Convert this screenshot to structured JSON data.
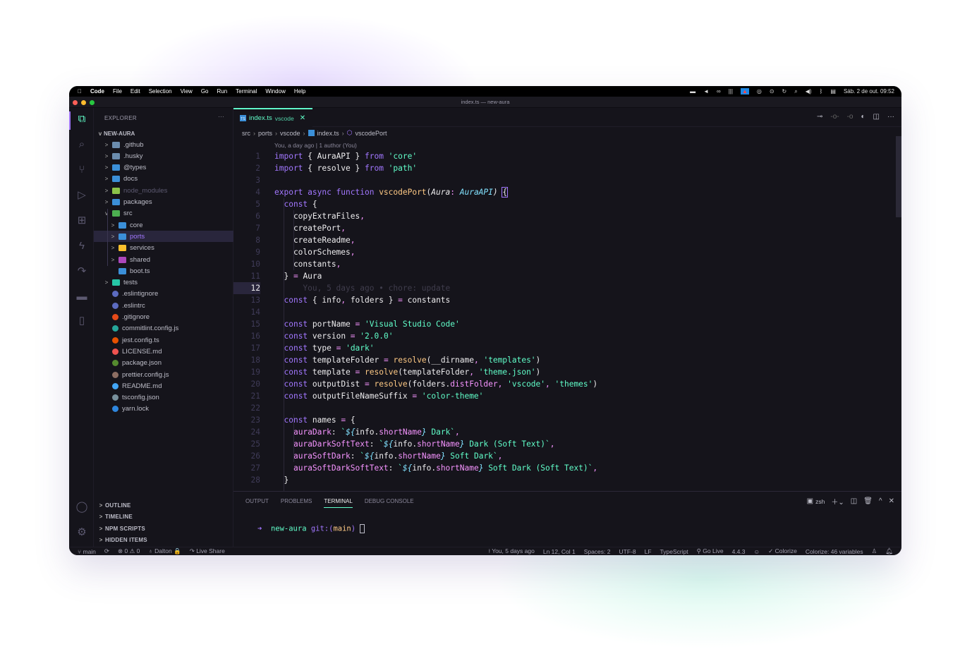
{
  "menubar": {
    "apple": "",
    "app": "Code",
    "items": [
      "File",
      "Edit",
      "Selection",
      "View",
      "Go",
      "Run",
      "Terminal",
      "Window",
      "Help"
    ],
    "clock": "Sáb. 2 de out.  09:52"
  },
  "window_title": "index.ts — new-aura",
  "colors": {
    "accent": "#61ffca",
    "purple": "#a277ff",
    "bg": "#15141b"
  },
  "sidebar": {
    "title": "EXPLORER",
    "more": "···",
    "root": "NEW-AURA",
    "items": [
      {
        "label": ".github",
        "depth": 0,
        "chev": ">",
        "color": "#6b8cae"
      },
      {
        "label": ".husky",
        "depth": 0,
        "chev": ">",
        "color": "#6b8cae"
      },
      {
        "label": "@types",
        "depth": 0,
        "chev": ">",
        "color": "#3b8fd8"
      },
      {
        "label": "docs",
        "depth": 0,
        "chev": ">",
        "color": "#3b8fd8"
      },
      {
        "label": "node_modules",
        "depth": 0,
        "chev": ">",
        "color": "#8bc34a",
        "dim": true
      },
      {
        "label": "packages",
        "depth": 0,
        "chev": ">",
        "color": "#3b8fd8"
      },
      {
        "label": "src",
        "depth": 0,
        "chev": "v",
        "color": "#4caf50"
      },
      {
        "label": "core",
        "depth": 1,
        "chev": ">",
        "color": "#3b8fd8"
      },
      {
        "label": "ports",
        "depth": 1,
        "chev": ">",
        "color": "#3b8fd8",
        "selected": true
      },
      {
        "label": "services",
        "depth": 1,
        "chev": ">",
        "color": "#fbc02d"
      },
      {
        "label": "shared",
        "depth": 1,
        "chev": ">",
        "color": "#ab47bc"
      },
      {
        "label": "boot.ts",
        "depth": 1,
        "chev": "",
        "color": "#3b8fd8"
      },
      {
        "label": "tests",
        "depth": 0,
        "chev": ">",
        "color": "#26c6a6"
      },
      {
        "label": ".eslintignore",
        "depth": 0,
        "chev": "",
        "color": "#5c6bc0",
        "file": true
      },
      {
        "label": ".eslintrc",
        "depth": 0,
        "chev": "",
        "color": "#5c6bc0",
        "file": true
      },
      {
        "label": ".gitignore",
        "depth": 0,
        "chev": "",
        "color": "#e64a19",
        "file": true
      },
      {
        "label": "commitlint.config.js",
        "depth": 0,
        "chev": "",
        "color": "#26a69a",
        "file": true
      },
      {
        "label": "jest.config.ts",
        "depth": 0,
        "chev": "",
        "color": "#e65100",
        "file": true
      },
      {
        "label": "LICENSE.md",
        "depth": 0,
        "chev": "",
        "color": "#ef5350",
        "file": true
      },
      {
        "label": "package.json",
        "depth": 0,
        "chev": "",
        "color": "#558b2f",
        "file": true
      },
      {
        "label": "prettier.config.js",
        "depth": 0,
        "chev": "",
        "color": "#8d6e63",
        "file": true
      },
      {
        "label": "README.md",
        "depth": 0,
        "chev": "",
        "color": "#42a5f5",
        "file": true
      },
      {
        "label": "tsconfig.json",
        "depth": 0,
        "chev": "",
        "color": "#78909c",
        "file": true
      },
      {
        "label": "yarn.lock",
        "depth": 0,
        "chev": "",
        "color": "#2e86de",
        "file": true
      }
    ],
    "sections": [
      "OUTLINE",
      "TIMELINE",
      "NPM SCRIPTS",
      "HIDDEN ITEMS"
    ]
  },
  "tab": {
    "name": "index.ts",
    "desc": "vscode",
    "icon": "TS"
  },
  "breadcrumbs": [
    "src",
    "ports",
    "vscode",
    "index.ts",
    "vscodePort"
  ],
  "blame_top": "You, a day ago | 1 author (You)",
  "current_line": 12,
  "code": [
    [
      [
        "k",
        "import"
      ],
      [
        "t",
        " { AuraAPI } "
      ],
      [
        "k",
        "from"
      ],
      [
        "s",
        " 'core'"
      ]
    ],
    [
      [
        "k",
        "import"
      ],
      [
        "t",
        " { resolve } "
      ],
      [
        "k",
        "from"
      ],
      [
        "s",
        " 'path'"
      ]
    ],
    [],
    [
      [
        "k",
        "export async function "
      ],
      [
        "f",
        "vscodePort"
      ],
      [
        "t",
        "("
      ],
      [
        "pa",
        "Aura"
      ],
      [
        "o",
        ": "
      ],
      [
        "ty",
        "AuraAPI"
      ],
      [
        "pa",
        ")"
      ],
      [
        "t",
        " "
      ],
      [
        "b",
        "{"
      ]
    ],
    [
      [
        "t",
        "  "
      ],
      [
        "k",
        "const"
      ],
      [
        "t",
        " {"
      ]
    ],
    [
      [
        "t",
        "    copyExtraFiles"
      ],
      [
        "o",
        ","
      ]
    ],
    [
      [
        "t",
        "    createPort"
      ],
      [
        "o",
        ","
      ]
    ],
    [
      [
        "t",
        "    createReadme"
      ],
      [
        "o",
        ","
      ]
    ],
    [
      [
        "t",
        "    colorSchemes"
      ],
      [
        "o",
        ","
      ]
    ],
    [
      [
        "t",
        "    constants"
      ],
      [
        "o",
        ","
      ]
    ],
    [
      [
        "t",
        "  } "
      ],
      [
        "o",
        "="
      ],
      [
        "t",
        " Aura"
      ]
    ],
    [
      [
        "g",
        "      You, 5 days ago • chore: update"
      ]
    ],
    [
      [
        "t",
        "  "
      ],
      [
        "k",
        "const"
      ],
      [
        "t",
        " { info"
      ],
      [
        "o",
        ","
      ],
      [
        "t",
        " folders } "
      ],
      [
        "o",
        "="
      ],
      [
        "t",
        " constants"
      ]
    ],
    [],
    [
      [
        "t",
        "  "
      ],
      [
        "k",
        "const"
      ],
      [
        "t",
        " portName "
      ],
      [
        "o",
        "="
      ],
      [
        "s",
        " 'Visual Studio Code'"
      ]
    ],
    [
      [
        "t",
        "  "
      ],
      [
        "k",
        "const"
      ],
      [
        "t",
        " version "
      ],
      [
        "o",
        "="
      ],
      [
        "s",
        " '2.0.0'"
      ]
    ],
    [
      [
        "t",
        "  "
      ],
      [
        "k",
        "const"
      ],
      [
        "t",
        " type "
      ],
      [
        "o",
        "="
      ],
      [
        "s",
        " 'dark'"
      ]
    ],
    [
      [
        "t",
        "  "
      ],
      [
        "k",
        "const"
      ],
      [
        "t",
        " templateFolder "
      ],
      [
        "o",
        "="
      ],
      [
        "t",
        " "
      ],
      [
        "f",
        "resolve"
      ],
      [
        "t",
        "(__dirname"
      ],
      [
        "o",
        ","
      ],
      [
        "s",
        " 'templates'"
      ],
      [
        "t",
        ")"
      ]
    ],
    [
      [
        "t",
        "  "
      ],
      [
        "k",
        "const"
      ],
      [
        "t",
        " template "
      ],
      [
        "o",
        "="
      ],
      [
        "t",
        " "
      ],
      [
        "f",
        "resolve"
      ],
      [
        "t",
        "(templateFolder"
      ],
      [
        "o",
        ","
      ],
      [
        "s",
        " 'theme.json'"
      ],
      [
        "t",
        ")"
      ]
    ],
    [
      [
        "t",
        "  "
      ],
      [
        "k",
        "const"
      ],
      [
        "t",
        " outputDist "
      ],
      [
        "o",
        "="
      ],
      [
        "t",
        " "
      ],
      [
        "f",
        "resolve"
      ],
      [
        "t",
        "(folders."
      ],
      [
        "p",
        "distFolder"
      ],
      [
        "o",
        ","
      ],
      [
        "s",
        " 'vscode'"
      ],
      [
        "o",
        ","
      ],
      [
        "s",
        " 'themes'"
      ],
      [
        "t",
        ")"
      ]
    ],
    [
      [
        "t",
        "  "
      ],
      [
        "k",
        "const"
      ],
      [
        "t",
        " outputFileNameSuffix "
      ],
      [
        "o",
        "="
      ],
      [
        "s",
        " 'color-theme'"
      ]
    ],
    [],
    [
      [
        "t",
        "  "
      ],
      [
        "k",
        "const"
      ],
      [
        "t",
        " names "
      ],
      [
        "o",
        "="
      ],
      [
        "t",
        " {"
      ]
    ],
    [
      [
        "t",
        "    "
      ],
      [
        "p",
        "auraDark"
      ],
      [
        "t",
        ": "
      ],
      [
        "s",
        "`"
      ],
      [
        "ty",
        "${"
      ],
      [
        "t",
        "info."
      ],
      [
        "p",
        "shortName"
      ],
      [
        "ty",
        "}"
      ],
      [
        "s",
        " Dark`"
      ],
      [
        "o",
        ","
      ]
    ],
    [
      [
        "t",
        "    "
      ],
      [
        "p",
        "auraDarkSoftText"
      ],
      [
        "t",
        ": "
      ],
      [
        "s",
        "`"
      ],
      [
        "ty",
        "${"
      ],
      [
        "t",
        "info."
      ],
      [
        "p",
        "shortName"
      ],
      [
        "ty",
        "}"
      ],
      [
        "s",
        " Dark (Soft Text)`"
      ],
      [
        "o",
        ","
      ]
    ],
    [
      [
        "t",
        "    "
      ],
      [
        "p",
        "auraSoftDark"
      ],
      [
        "t",
        ": "
      ],
      [
        "s",
        "`"
      ],
      [
        "ty",
        "${"
      ],
      [
        "t",
        "info."
      ],
      [
        "p",
        "shortName"
      ],
      [
        "ty",
        "}"
      ],
      [
        "s",
        " Soft Dark`"
      ],
      [
        "o",
        ","
      ]
    ],
    [
      [
        "t",
        "    "
      ],
      [
        "p",
        "auraSoftDarkSoftText"
      ],
      [
        "t",
        ": "
      ],
      [
        "s",
        "`"
      ],
      [
        "ty",
        "${"
      ],
      [
        "t",
        "info."
      ],
      [
        "p",
        "shortName"
      ],
      [
        "ty",
        "}"
      ],
      [
        "s",
        " Soft Dark (Soft Text)`"
      ],
      [
        "o",
        ","
      ]
    ],
    [
      [
        "t",
        "  }"
      ]
    ]
  ],
  "panel": {
    "tabs": [
      "OUTPUT",
      "PROBLEMS",
      "TERMINAL",
      "DEBUG CONSOLE"
    ],
    "active": "TERMINAL",
    "shell": "zsh",
    "prompt": {
      "arrow": "➜",
      "dir": "new-aura",
      "git": "git:(",
      "branch": "main",
      "close": ")"
    }
  },
  "status": {
    "branch": "main",
    "sync": "⟳",
    "errors": "0",
    "warnings": "0",
    "user": "Dalton",
    "liveshare": "Live Share",
    "blame": "You, 5 days ago",
    "position": "Ln 12, Col 1",
    "spaces": "Spaces: 2",
    "encoding": "UTF-8",
    "eol": "LF",
    "language": "TypeScript",
    "golive": "Go Live",
    "version": "4.4.3",
    "colorize": "✓ Colorize",
    "colorize_vars": "Colorize: 46 variables"
  }
}
